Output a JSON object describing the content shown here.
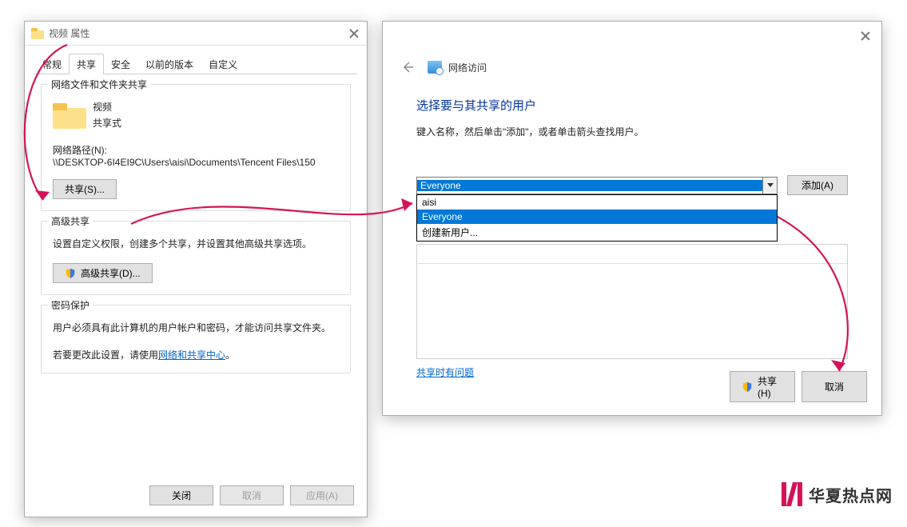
{
  "left": {
    "title": "视频 属性",
    "tabs": [
      "常规",
      "共享",
      "安全",
      "以前的版本",
      "自定义"
    ],
    "active_tab_index": 1,
    "group1": {
      "legend": "网络文件和文件夹共享",
      "folder_name": "视频",
      "share_status": "共享式",
      "path_label": "网络路径(N):",
      "path_value": "\\\\DESKTOP-6I4EI9C\\Users\\aisi\\Documents\\Tencent Files\\150",
      "share_button": "共享(S)..."
    },
    "group2": {
      "legend": "高级共享",
      "desc": "设置自定义权限，创建多个共享，并设置其他高级共享选项。",
      "button": "高级共享(D)..."
    },
    "group3": {
      "legend": "密码保护",
      "line1": "用户必须具有此计算机的用户帐户和密码，才能访问共享文件夹。",
      "line2_prefix": "若要更改此设置，请使用",
      "line2_link": "网络和共享中心",
      "line2_suffix": "。"
    },
    "buttons": {
      "close": "关闭",
      "cancel": "取消",
      "apply": "应用(A)"
    }
  },
  "right": {
    "nav_title": "网络访问",
    "heading": "选择要与其共享的用户",
    "instruction": "键入名称，然后单击\"添加\"，或者单击箭头查找用户。",
    "combo_value": "Everyone",
    "dropdown_items": [
      "aisi",
      "Everyone",
      "创建新用户..."
    ],
    "dropdown_hover_index": 1,
    "add_button": "添加(A)",
    "problem_link": "共享时有问题",
    "share_button": "共享(H)",
    "cancel_button": "取消"
  },
  "watermark": "华夏热点网"
}
